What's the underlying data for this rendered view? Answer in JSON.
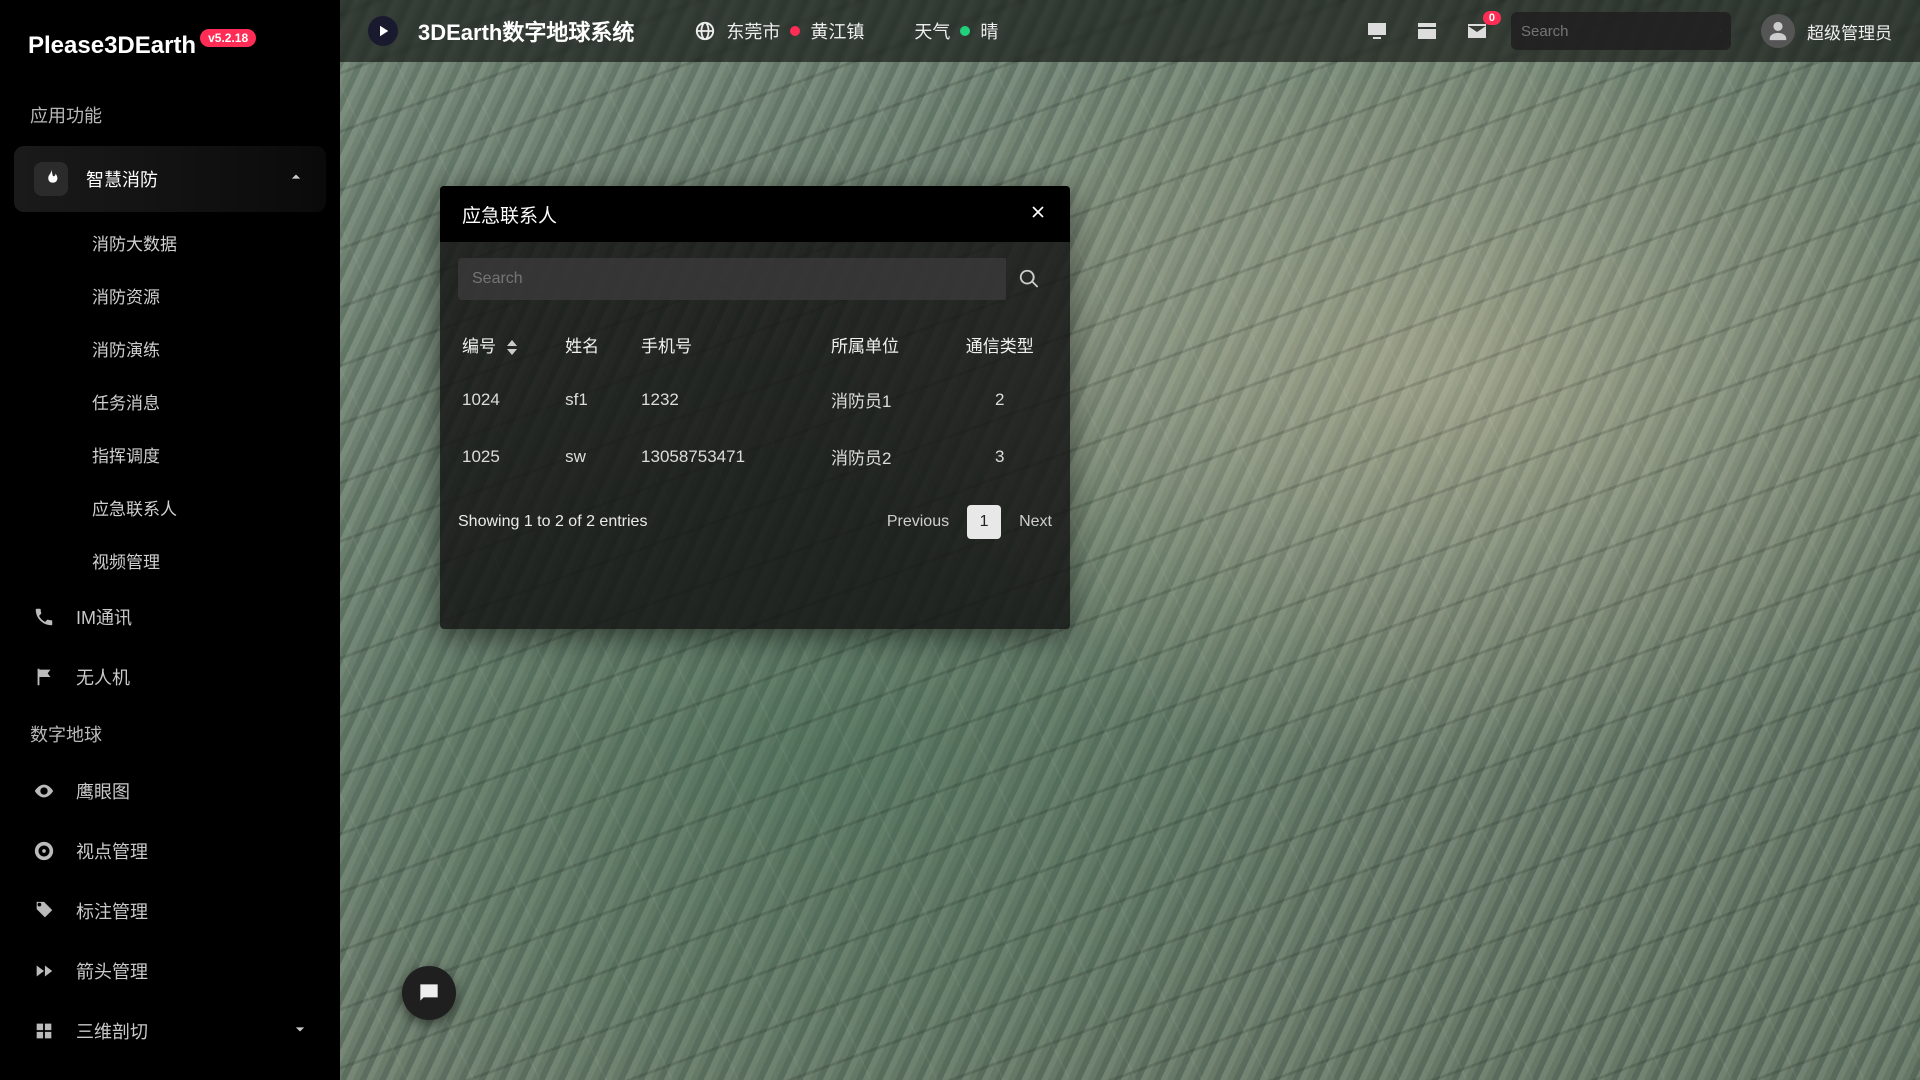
{
  "brand": {
    "name": "Please3DEarth",
    "version": "v5.2.18"
  },
  "sidebar": {
    "section1_title": "应用功能",
    "parent": {
      "label": "智慧消防"
    },
    "subs": [
      "消防大数据",
      "消防资源",
      "消防演练",
      "任务消息",
      "指挥调度",
      "应急联系人",
      "视频管理"
    ],
    "items_after": [
      {
        "label": "IM通讯",
        "icon": "phone"
      },
      {
        "label": "无人机",
        "icon": "flag"
      }
    ],
    "section2_title": "数字地球",
    "earth_items": [
      {
        "label": "鹰眼图",
        "icon": "eye"
      },
      {
        "label": "视点管理",
        "icon": "target"
      },
      {
        "label": "标注管理",
        "icon": "tag"
      },
      {
        "label": "箭头管理",
        "icon": "forward"
      },
      {
        "label": "三维剖切",
        "icon": "cut",
        "chev": true
      }
    ]
  },
  "topbar": {
    "app_title": "3DEarth数字地球系统",
    "city": "东莞市",
    "district": "黄江镇",
    "weather_label": "天气",
    "weather_value": "晴",
    "search_placeholder": "Search",
    "badge_count": "0",
    "user_name": "超级管理员"
  },
  "panel": {
    "title": "应急联系人",
    "search_placeholder": "Search",
    "columns": [
      "编号",
      "姓名",
      "手机号",
      "所属单位",
      "通信类型"
    ],
    "rows": [
      {
        "c0": "1024",
        "c1": "sf1",
        "c2": "1232",
        "c3": "消防员1",
        "c4": "2"
      },
      {
        "c0": "1025",
        "c1": "sw",
        "c2": "13058753471",
        "c3": "消防员2",
        "c4": "3"
      }
    ],
    "entries_text": "Showing 1 to 2 of 2 entries",
    "previous": "Previous",
    "next": "Next",
    "page_current": "1"
  }
}
